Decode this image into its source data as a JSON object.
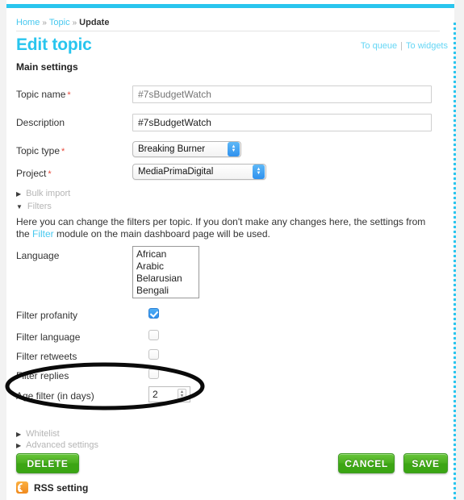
{
  "theme": {
    "accent": "#29c5ee",
    "link": "#46c8ef",
    "required": "#e8483a",
    "button_green": "#49ad1d",
    "rss_orange": "#f08a1e"
  },
  "breadcrumb": {
    "home": "Home",
    "topic": "Topic",
    "current": "Update",
    "separator": "»"
  },
  "header": {
    "title": "Edit topic",
    "to_queue": "To queue",
    "to_widgets": "To widgets",
    "divider": "|"
  },
  "main_settings": {
    "section_label": "Main settings",
    "fields": [
      {
        "label": "Topic name",
        "required": "*",
        "value": "",
        "placeholder": "#7sBudgetWatch",
        "type": "text"
      },
      {
        "label": "Description",
        "required": "",
        "value": "#7sBudgetWatch",
        "placeholder": "",
        "type": "text"
      },
      {
        "label": "Topic type",
        "required": "*",
        "value": "Breaking Burner",
        "type": "select"
      },
      {
        "label": "Project",
        "required": "*",
        "value": "MediaPrimaDigital",
        "type": "select"
      }
    ]
  },
  "collapsibles_top": [
    {
      "label": "Bulk import",
      "state": "collapsed",
      "marker": "▶"
    },
    {
      "label": "Filters",
      "state": "expanded",
      "marker": "▼"
    }
  ],
  "filters": {
    "description_part1": "Here you can change the filters per topic. If you don't make any changes here, the settings from the ",
    "description_link": "Filter",
    "description_part2": " module on the main dashboard page will be used.",
    "language_label": "Language",
    "languages": [
      "African",
      "Arabic",
      "Belarusian",
      "Bengali"
    ],
    "checkboxes": [
      {
        "label": "Filter profanity",
        "checked": true
      },
      {
        "label": "Filter language",
        "checked": false
      },
      {
        "label": "Filter retweets",
        "checked": false
      },
      {
        "label": "Filter replies",
        "checked": false
      }
    ],
    "age_filter": {
      "label": "Age filter (in days)",
      "value": "2"
    }
  },
  "collapsibles_bottom": [
    {
      "label": "Whitelist",
      "state": "collapsed",
      "marker": "▶"
    },
    {
      "label": "Advanced settings",
      "state": "collapsed",
      "marker": "▶"
    }
  ],
  "actions": {
    "delete": "DELETE",
    "cancel": "CANCEL",
    "save": "SAVE"
  },
  "rss": {
    "label": "RSS setting",
    "icon": "rss-icon"
  },
  "annotation": {
    "shape": "ellipse",
    "color": "#000000",
    "targets": "age-filter-row"
  }
}
